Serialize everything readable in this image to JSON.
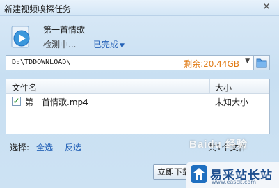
{
  "window": {
    "title": "新建视频嗅探任务",
    "close_glyph": "✕"
  },
  "video": {
    "name": "第一首情歌",
    "status": "检测中...",
    "done_label": "已完成"
  },
  "save_path": {
    "value": "D:\\TDDOWNLOAD\\",
    "free_space": "剩余:20.44GB"
  },
  "file_list": {
    "headers": {
      "name": "文件名",
      "size": "大小"
    },
    "rows": [
      {
        "checked": true,
        "name": "第一首情歌.mp4",
        "size": "未知大小"
      }
    ]
  },
  "footer": {
    "select_label": "选择:",
    "select_all": "全选",
    "invert": "反选",
    "count_text": "共1个文件",
    "download_button": "立即下载"
  },
  "watermarks": {
    "baidu": "Baidu 经验",
    "site_name": "易采站长站",
    "site_url": "www.easck.com"
  },
  "colors": {
    "link": "#2663b8",
    "free_space": "#e07a14",
    "accent_blue": "#1f6fc0"
  }
}
